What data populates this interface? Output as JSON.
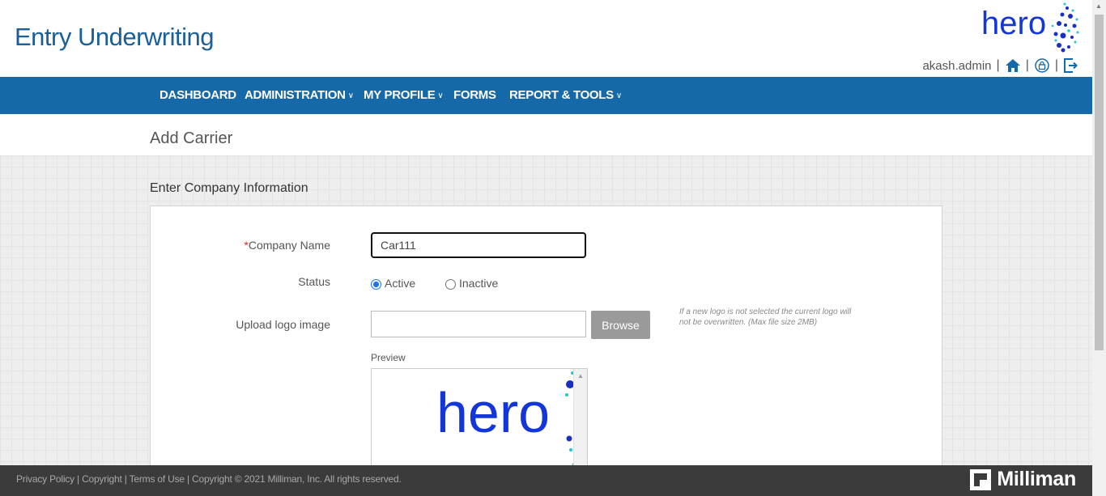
{
  "app": {
    "title": "Entry Underwriting",
    "logo_text": "hero"
  },
  "user": {
    "name": "akash.admin"
  },
  "icons": {
    "home": "home-icon",
    "lock": "lock-refresh-icon",
    "logout": "logout-icon",
    "chevron": "chevron-down-icon",
    "brand": "milliman-logo-icon"
  },
  "colors": {
    "brand_blue": "#1669a8",
    "title_blue": "#1a5f98",
    "footer_bg": "#3b3b3b",
    "required": "#dd2222"
  },
  "nav": {
    "items": [
      {
        "label": "DASHBOARD",
        "dropdown": false
      },
      {
        "label": "ADMINISTRATION",
        "dropdown": true
      },
      {
        "label": "MY PROFILE",
        "dropdown": true
      },
      {
        "label": "FORMS",
        "dropdown": false
      },
      {
        "label": "REPORT & TOOLS",
        "dropdown": true
      }
    ]
  },
  "page": {
    "title": "Add Carrier",
    "section_title": "Enter Company Information"
  },
  "form": {
    "company_name_label": "Company Name",
    "company_name_required_mark": "*",
    "company_name_value": "Car111",
    "status_label": "Status",
    "status_options": [
      "Active",
      "Inactive"
    ],
    "status_selected": "Active",
    "upload_label": "Upload logo image",
    "upload_value": "",
    "browse_label": "Browse",
    "hint": "If a new logo is not selected the current logo will not be overwritten. (Max file size 2MB)",
    "preview_label": "Preview",
    "preview_logo_text": "hero"
  },
  "footer": {
    "links": "Privacy Policy | Copyright | Terms of Use | Copyright © 2021 Milliman, Inc. All rights reserved.",
    "brand": "Milliman"
  }
}
